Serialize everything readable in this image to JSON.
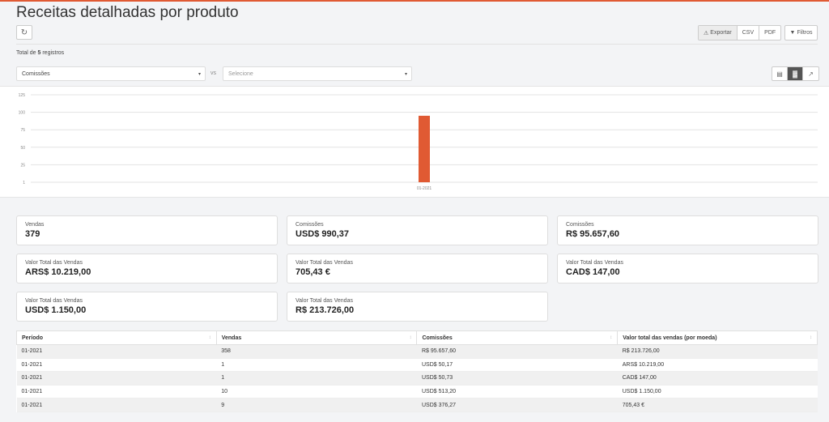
{
  "page": {
    "title": "Receitas detalhadas por produto"
  },
  "toolbar": {
    "export_label": "Exportar",
    "csv_label": "CSV",
    "pdf_label": "PDF",
    "filters_label": "Filtros"
  },
  "summary": {
    "total_prefix": "Total de",
    "total_count": "5",
    "total_suffix": "registros"
  },
  "selectors": {
    "primary": "Comissões",
    "vs_label": "vs",
    "secondary": "Selecione"
  },
  "chart_data": {
    "type": "bar",
    "categories": [
      "01-2021"
    ],
    "values": [
      95
    ],
    "ytick_labels": [
      "125",
      "100",
      "75",
      "50",
      "25",
      "1"
    ],
    "ylim": [
      0,
      125
    ],
    "bar_color": "#e05a33",
    "grid": true
  },
  "cards": [
    {
      "label": "Vendas",
      "value": "379"
    },
    {
      "label": "Comissões",
      "value": "USD$ 990,37"
    },
    {
      "label": "Comissões",
      "value": "R$ 95.657,60"
    },
    {
      "label": "Valor Total das Vendas",
      "value": "ARS$ 10.219,00"
    },
    {
      "label": "Valor Total das Vendas",
      "value": "705,43 €"
    },
    {
      "label": "Valor Total das Vendas",
      "value": "CAD$ 147,00"
    },
    {
      "label": "Valor Total das Vendas",
      "value": "USD$ 1.150,00"
    },
    {
      "label": "Valor Total das Vendas",
      "value": "R$ 213.726,00"
    }
  ],
  "table": {
    "columns": [
      "Período",
      "Vendas",
      "Comissões",
      "Valor total das vendas (por moeda)"
    ],
    "rows": [
      [
        "01-2021",
        "358",
        "R$ 95.657,60",
        "R$ 213.726,00"
      ],
      [
        "01-2021",
        "1",
        "USD$ 50,17",
        "ARS$ 10.219,00"
      ],
      [
        "01-2021",
        "1",
        "USD$ 50,73",
        "CAD$ 147,00"
      ],
      [
        "01-2021",
        "10",
        "USD$ 513,20",
        "USD$ 1.150,00"
      ],
      [
        "01-2021",
        "9",
        "USD$ 376,27",
        "705,43 €"
      ]
    ]
  },
  "colors": {
    "accent": "#e05a33",
    "background": "#f3f4f6"
  }
}
